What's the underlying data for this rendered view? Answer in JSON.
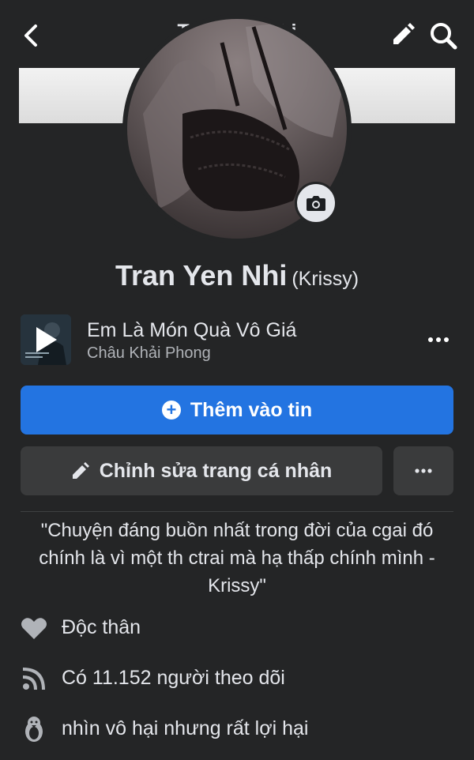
{
  "header": {
    "title": "Tran Yen Nhi",
    "back_icon": "chevron-left-icon",
    "edit_icon": "pencil-icon",
    "search_icon": "search-icon"
  },
  "profile": {
    "name": "Tran Yen Nhi",
    "alternate_name": "(Krissy)",
    "camera_icon": "camera-icon"
  },
  "music": {
    "title": "Em Là Món Quà Vô Giá",
    "artist": "Châu Khải Phong",
    "more_icon": "more-horizontal-icon"
  },
  "actions": {
    "add_story_label": "Thêm vào tin",
    "edit_profile_label": "Chỉnh sửa trang cá nhân"
  },
  "bio": {
    "text": "\"Chuyện đáng buồn nhất trong đời của cgai đó chính là vì một th ctrai mà hạ thấp chính mình - Krissy\""
  },
  "details": [
    {
      "icon": "heart-icon",
      "text": "Độc thân"
    },
    {
      "icon": "rss-icon",
      "text": "Có 11.152 người theo dõi"
    },
    {
      "icon": "penguin-icon",
      "text": "nhìn vô hại nhưng rất lợi hại"
    }
  ],
  "colors": {
    "background": "#242526",
    "primary_blue": "#2374e1",
    "secondary_button": "#3a3b3c",
    "text_primary": "#e4e6eb",
    "text_secondary": "#b0b3b8"
  }
}
